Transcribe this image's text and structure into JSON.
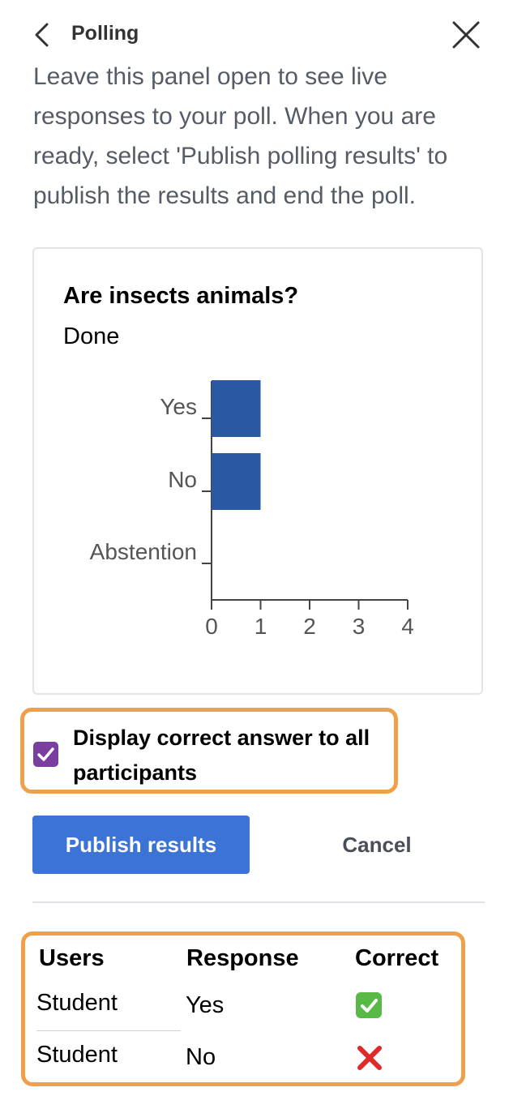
{
  "header": {
    "title": "Polling"
  },
  "intro_text": "Leave this panel open to see live responses to your poll. When you are ready, select 'Publish polling results' to publish the results and end the poll.",
  "poll": {
    "question": "Are insects animals?",
    "status": "Done"
  },
  "chart_data": {
    "type": "bar",
    "orientation": "horizontal",
    "categories": [
      "Yes",
      "No",
      "Abstention"
    ],
    "values": [
      1,
      1,
      0
    ],
    "xticks": [
      "0",
      "1",
      "2",
      "3",
      "4"
    ],
    "xlim": [
      0,
      4
    ],
    "bar_color": "#2a58a3"
  },
  "options": {
    "display_correct_label": "Display correct answer to all participants",
    "display_correct_checked": true
  },
  "actions": {
    "publish_label": "Publish results",
    "cancel_label": "Cancel"
  },
  "responses": {
    "headers": {
      "users": "Users",
      "response": "Response",
      "correct": "Correct"
    },
    "rows": [
      {
        "user": "Student",
        "response": "Yes",
        "correct": true
      },
      {
        "user": "Student",
        "response": "No",
        "correct": false
      }
    ]
  },
  "colors": {
    "accent": "#3b73d6",
    "highlight": "#f0a04b",
    "checkbox": "#7a3ea1"
  }
}
